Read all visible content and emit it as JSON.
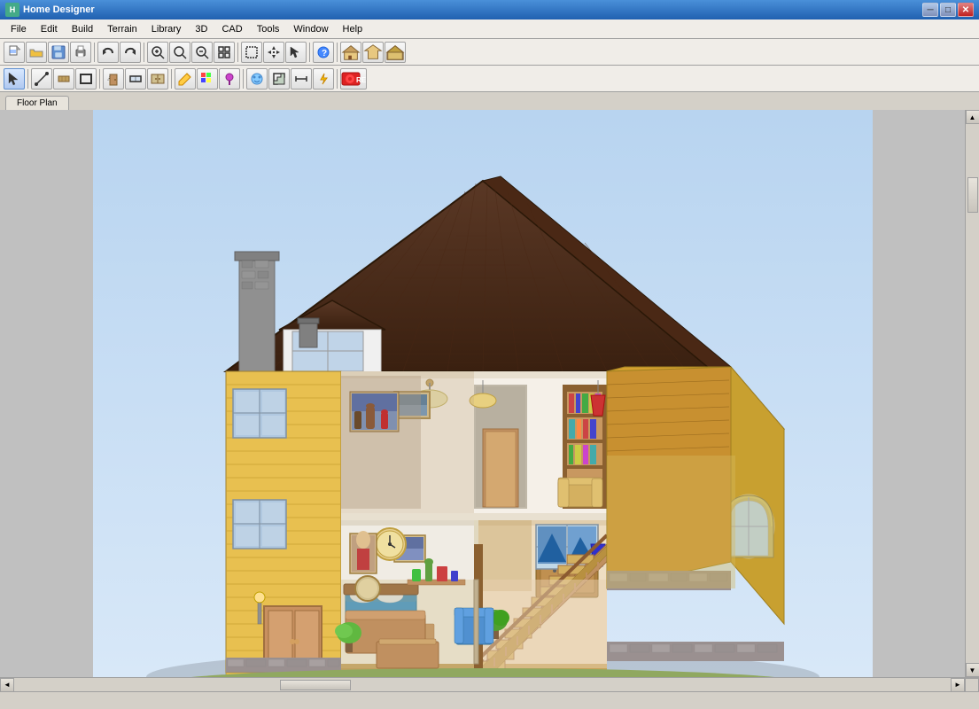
{
  "window": {
    "title": "Home Designer",
    "icon": "HD"
  },
  "menu": {
    "items": [
      "File",
      "Edit",
      "Build",
      "Terrain",
      "Library",
      "3D",
      "CAD",
      "Tools",
      "Window",
      "Help"
    ]
  },
  "toolbar1": {
    "buttons": [
      {
        "icon": "📄",
        "name": "new",
        "label": "New"
      },
      {
        "icon": "📂",
        "name": "open",
        "label": "Open"
      },
      {
        "icon": "💾",
        "name": "save",
        "label": "Save"
      },
      {
        "icon": "🖨",
        "name": "print",
        "label": "Print"
      },
      {
        "icon": "↩",
        "name": "undo",
        "label": "Undo"
      },
      {
        "icon": "↪",
        "name": "redo",
        "label": "Redo"
      },
      {
        "icon": "🔍",
        "name": "zoom-in",
        "label": "Zoom In"
      },
      {
        "icon": "⊕",
        "name": "zoom-real",
        "label": "Zoom"
      },
      {
        "icon": "⊖",
        "name": "zoom-out",
        "label": "Zoom Out"
      },
      {
        "icon": "⤢",
        "name": "fit",
        "label": "Fit"
      },
      {
        "icon": "⬛",
        "name": "select-area",
        "label": "Select Area"
      },
      {
        "icon": "↔",
        "name": "move",
        "label": "Move"
      },
      {
        "icon": "→",
        "name": "arrow",
        "label": "Arrow"
      },
      {
        "icon": "?",
        "name": "help-cursor",
        "label": "Help Cursor"
      },
      {
        "icon": "🏠",
        "name": "house",
        "label": "House"
      },
      {
        "icon": "🏘",
        "name": "house2",
        "label": "House 2"
      },
      {
        "icon": "🏗",
        "name": "house3",
        "label": "House 3"
      }
    ]
  },
  "toolbar2": {
    "buttons": [
      {
        "icon": "↖",
        "name": "select",
        "label": "Select"
      },
      {
        "icon": "〰",
        "name": "line",
        "label": "Line"
      },
      {
        "icon": "━",
        "name": "wall",
        "label": "Wall"
      },
      {
        "icon": "⬜",
        "name": "room",
        "label": "Room"
      },
      {
        "icon": "🚪",
        "name": "door",
        "label": "Door"
      },
      {
        "icon": "▭",
        "name": "window-tool",
        "label": "Window"
      },
      {
        "icon": "◰",
        "name": "cabinet",
        "label": "Cabinet"
      },
      {
        "icon": "✏",
        "name": "draw",
        "label": "Draw"
      },
      {
        "icon": "🎨",
        "name": "material",
        "label": "Material"
      },
      {
        "icon": "⊙",
        "name": "object",
        "label": "Object"
      },
      {
        "icon": "↑",
        "name": "stair",
        "label": "Stair"
      },
      {
        "icon": "⊞",
        "name": "dimension",
        "label": "Dimension"
      },
      {
        "icon": "⬤",
        "name": "record",
        "label": "Record"
      }
    ]
  },
  "canvas": {
    "background": "#c0c0c0"
  },
  "statusbar": {
    "text": ""
  }
}
